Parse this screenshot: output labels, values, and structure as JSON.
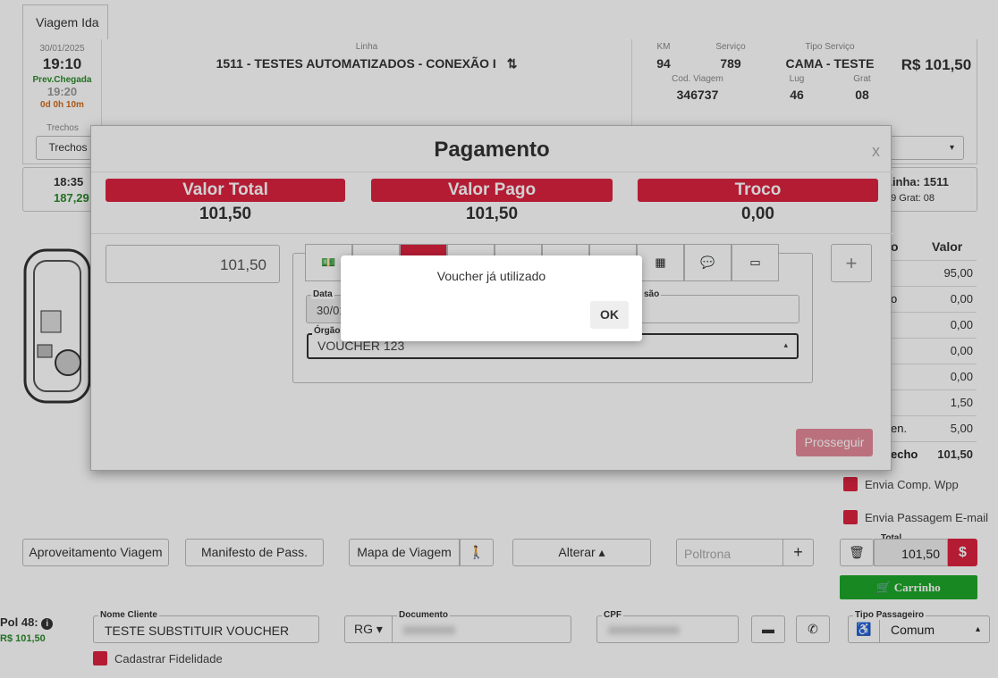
{
  "tab": {
    "label": "Viagem Ida"
  },
  "trip": {
    "date": "30/01/2025",
    "time": "19:10",
    "arrival_label": "Prev.Chegada",
    "arrival_time": "19:20",
    "duration": "0d 0h 10m",
    "segments_label": "Trechos",
    "segments_button": "Trechos",
    "line_label": "Linha",
    "line_value": "1511 - TESTES AUTOMATIZADOS - CONEXÃO I",
    "km_label": "KM",
    "km_value": "94",
    "service_label": "Serviço",
    "service_value": "789",
    "service_type_label": "Tipo Serviço",
    "service_type_value": "CAMA - TESTE",
    "price": "R$ 101,50",
    "trip_code_label": "Cod. Viagem",
    "trip_code_value": "346737",
    "seats_label": "Lug",
    "seats_value": "46",
    "free_label": "Grat",
    "free_value": "08",
    "seg_time": "18:35",
    "seg_price": "187,29",
    "seg_line": "Linha: 1511",
    "seg_info": "29 Grat: 08"
  },
  "summary": {
    "value_header": "Valor",
    "values": [
      "95,00",
      "0,00",
      "0,00",
      "0,00",
      "0,00",
      "1,50",
      "5,00",
      "101,50"
    ],
    "partial_labels": [
      "",
      "o",
      "",
      "",
      "",
      "",
      "en.",
      "echo"
    ]
  },
  "options": {
    "whatsapp": "Envia Comp. Wpp",
    "email": "Envia Passagem E-mail"
  },
  "actions": {
    "reuse": "Aproveitamento Viagem",
    "manifest": "Manifesto de Pass.",
    "map": "Mapa de Viagem",
    "alter": "Alterar",
    "seat_placeholder": "Poltrona",
    "total_label": "Total",
    "total_value": "101,50",
    "cart": "Carrinho"
  },
  "passenger": {
    "seat_label": "Pol 48:",
    "seat_price": "R$ 101,50",
    "name_label": "Nome Cliente",
    "name_value": "TESTE SUBSTITUIR VOUCHER",
    "doc_type": "RG",
    "doc_label": "Documento",
    "doc_value": "00000000",
    "cpf_label": "CPF",
    "cpf_value": "00000000000",
    "type_label": "Tipo Passageiro",
    "type_value": "Comum",
    "loyalty": "Cadastrar Fidelidade"
  },
  "payment": {
    "title": "Pagamento",
    "close": "x",
    "total_label": "Valor Total",
    "total_value": "101,50",
    "paid_label": "Valor Pago",
    "paid_value": "101,50",
    "change_label": "Troco",
    "change_value": "0,00",
    "amount_input": "101,50",
    "date_label": "Data",
    "date_value": "30/01",
    "issuer_label": "são",
    "organ_label": "Órgão",
    "organ_value": "VOUCHER 123",
    "proceed": "Prosseguir"
  },
  "dialog": {
    "message": "Voucher já utilizado",
    "ok": "OK"
  },
  "colors": {
    "accent_red": "#dc2340",
    "cart_green": "#1ea82a"
  }
}
